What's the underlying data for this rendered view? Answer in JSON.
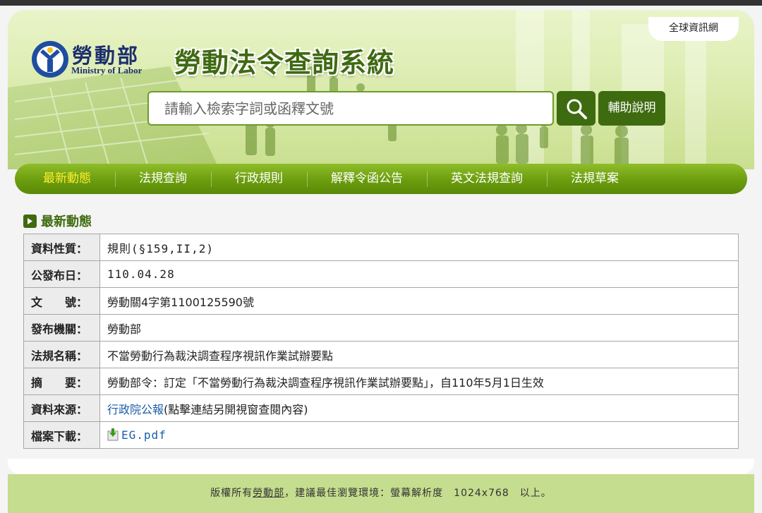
{
  "header": {
    "global_link": "全球資訊網",
    "logo_cn": "勞動部",
    "logo_en": "Ministry of Labor",
    "system_title": "勞動法令查詢系統",
    "search_placeholder": "請輸入檢索字詞或函釋文號",
    "help_label": "輔助說明"
  },
  "nav": {
    "items": [
      {
        "label": "最新動態",
        "active": true
      },
      {
        "label": "法規查詢"
      },
      {
        "label": "行政規則"
      },
      {
        "label": "解釋令函公告"
      },
      {
        "label": "英文法規查詢"
      },
      {
        "label": "法規草案"
      }
    ]
  },
  "section": {
    "title": "最新動態"
  },
  "detail": {
    "rows": [
      {
        "label": "資料性質：",
        "value": "規則(§159,II,2)"
      },
      {
        "label": "公發布日：",
        "value": "110.04.28"
      },
      {
        "label": "文　　號：",
        "value": "勞動關4字第1100125590號"
      },
      {
        "label": "發布機關：",
        "value": "勞動部"
      },
      {
        "label": "法規名稱：",
        "value": "不當勞動行為裁決調查程序視訊作業試辦要點"
      },
      {
        "label": "摘　　要：",
        "value": "勞動部令：訂定「不當勞動行為裁決調查程序視訊作業試辦要點」，自110年5月1日生效"
      },
      {
        "label": "資料來源：",
        "link": "行政院公報",
        "value": "(點擊連結另開視窗查閱內容)"
      },
      {
        "label": "檔案下載：",
        "file": "EG.pdf"
      }
    ]
  },
  "footer": {
    "prefix": "版權所有",
    "org_link": "勞動部",
    "suffix": "，建議最佳瀏覽環境：螢幕解析度　1024x768　以上。"
  },
  "colors": {
    "nav_green": "#6b9d0e",
    "nav_active_text": "#ffec2e",
    "dark_green": "#3f6b10",
    "link_blue": "#1a5ea8"
  }
}
